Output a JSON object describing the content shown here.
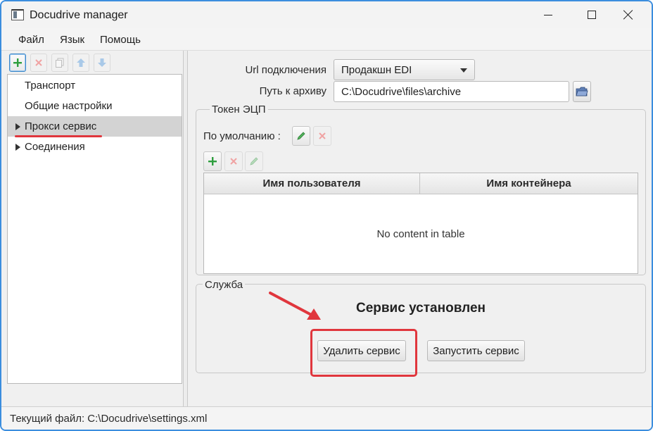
{
  "window": {
    "title": "Docudrive manager"
  },
  "menu": {
    "items": [
      "Файл",
      "Язык",
      "Помощь"
    ]
  },
  "tree": {
    "items": [
      {
        "label": "Транспорт",
        "expandable": false,
        "selected": false
      },
      {
        "label": "Общие настройки",
        "expandable": false,
        "selected": false
      },
      {
        "label": "Прокси сервис",
        "expandable": true,
        "selected": true
      },
      {
        "label": "Соединения",
        "expandable": true,
        "selected": false
      }
    ]
  },
  "form": {
    "url_label": "Url подключения",
    "url_value": "Продакшн EDI",
    "archive_label": "Путь к архиву",
    "archive_value": "C:\\Docudrive\\files\\archive"
  },
  "token": {
    "title": "Токен ЭЦП",
    "default_label": "По умолчанию :",
    "columns": [
      "Имя пользователя",
      "Имя контейнера"
    ],
    "empty_message": "No content in table"
  },
  "service": {
    "title": "Служба",
    "status": "Сервис установлен",
    "remove_label": "Удалить сервис",
    "start_label": "Запустить сервис"
  },
  "status_bar": {
    "text": "Текущий файл: C:\\Docudrive\\settings.xml"
  },
  "colors": {
    "annotation_red": "#e0363d",
    "accent_blue": "#3a86c8",
    "add_green": "#2e9e3e"
  }
}
